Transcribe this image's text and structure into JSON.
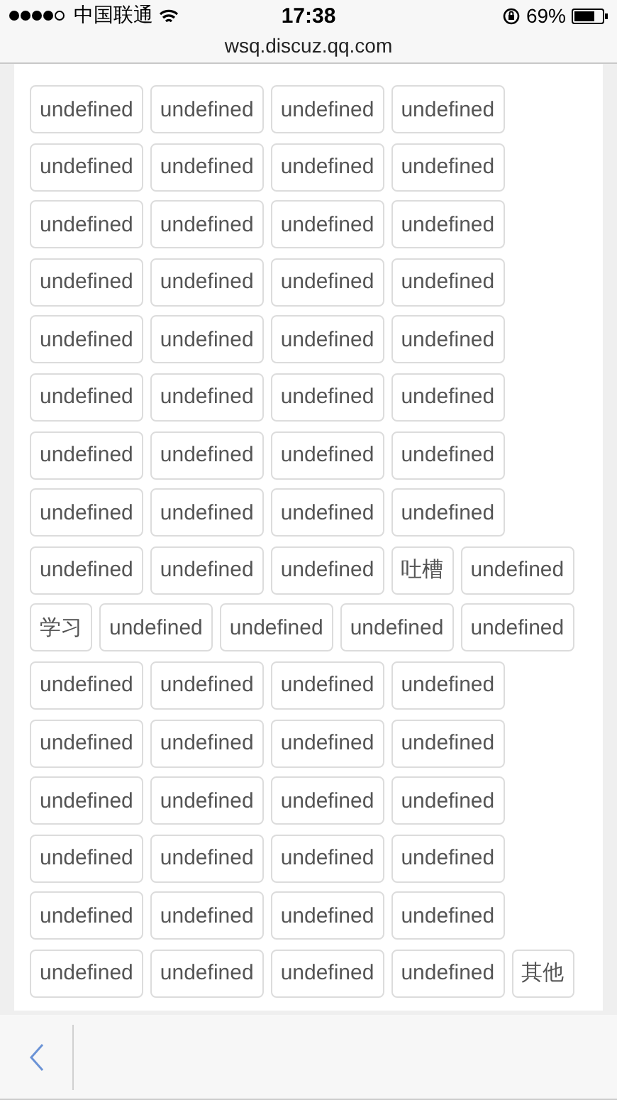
{
  "status_bar": {
    "carrier": "中国联通",
    "time": "17:38",
    "battery": "69%"
  },
  "address_bar": {
    "url": "wsq.discuz.qq.com"
  },
  "tag_rows": [
    [
      "undefined",
      "undefined",
      "undefined",
      "undefined"
    ],
    [
      "undefined",
      "undefined",
      "undefined",
      "undefined"
    ],
    [
      "undefined",
      "undefined",
      "undefined",
      "undefined"
    ],
    [
      "undefined",
      "undefined",
      "undefined",
      "undefined"
    ],
    [
      "undefined",
      "undefined",
      "undefined",
      "undefined"
    ],
    [
      "undefined",
      "undefined",
      "undefined",
      "undefined"
    ],
    [
      "undefined",
      "undefined",
      "undefined",
      "undefined"
    ],
    [
      "undefined",
      "undefined",
      "undefined",
      "undefined"
    ],
    [
      "undefined",
      "undefined",
      "undefined",
      "吐槽",
      "undefined"
    ],
    [
      "学习",
      "undefined",
      "undefined",
      "undefined",
      "undefined"
    ],
    [
      "undefined",
      "undefined",
      "undefined",
      "undefined"
    ],
    [
      "undefined",
      "undefined",
      "undefined",
      "undefined"
    ],
    [
      "undefined",
      "undefined",
      "undefined",
      "undefined"
    ],
    [
      "undefined",
      "undefined",
      "undefined",
      "undefined"
    ],
    [
      "undefined",
      "undefined",
      "undefined",
      "undefined"
    ],
    [
      "undefined",
      "undefined",
      "undefined",
      "undefined",
      "其他"
    ]
  ]
}
